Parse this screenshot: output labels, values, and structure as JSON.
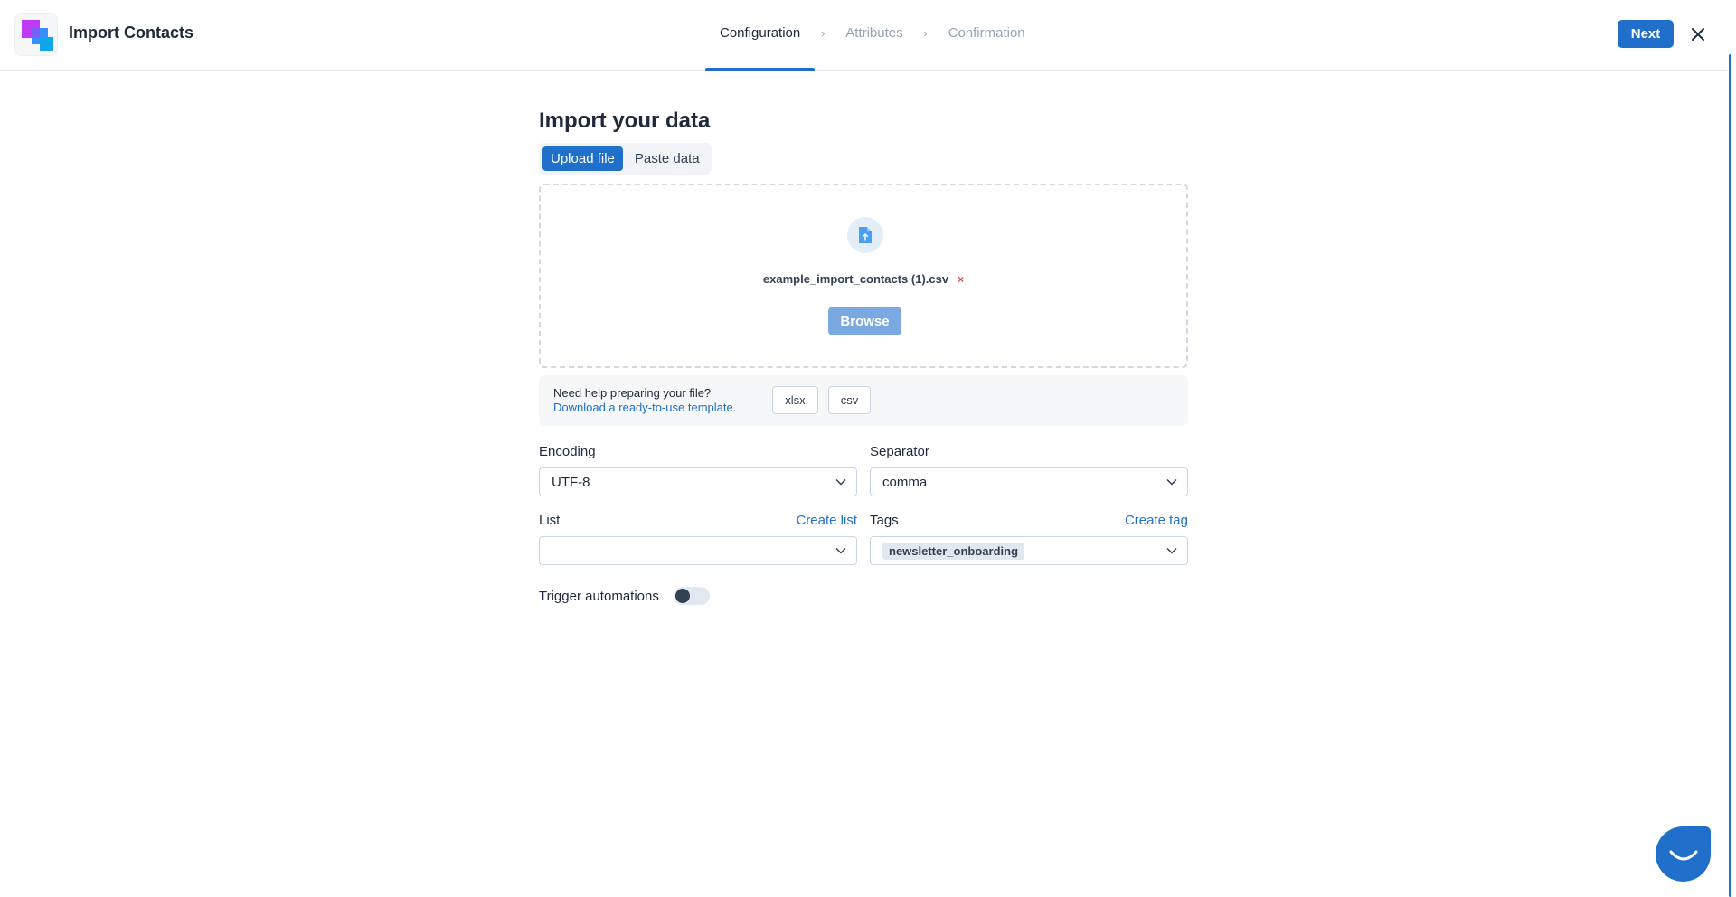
{
  "header": {
    "title": "Import Contacts",
    "steps": [
      {
        "label": "Configuration"
      },
      {
        "label": "Attributes"
      },
      {
        "label": "Confirmation"
      }
    ],
    "step_separator": "›",
    "next_label": "Next",
    "active_step": "Configuration"
  },
  "main": {
    "title": "Import your data",
    "tabs": [
      {
        "label": "Upload file"
      },
      {
        "label": "Paste data"
      }
    ],
    "active_tab": "Upload file",
    "upload": {
      "file_name": "example_import_contacts (1).csv",
      "remove_symbol": "×",
      "browse_label": "Browse",
      "icon": "file-upload-icon"
    },
    "help": {
      "title": "Need help preparing your file?",
      "subtitle": "Download a ready-to-use template.",
      "formats": [
        "xlsx",
        "csv"
      ]
    },
    "fields": {
      "encoding": {
        "label": "Encoding",
        "value": "UTF-8"
      },
      "separator": {
        "label": "Separator",
        "value": "comma"
      },
      "list": {
        "label": "List",
        "link": "Create list",
        "value": ""
      },
      "tags": {
        "label": "Tags",
        "link": "Create tag",
        "selected": [
          "newsletter_onboarding"
        ]
      }
    },
    "trigger": {
      "label": "Trigger automations",
      "enabled": false
    }
  },
  "colors": {
    "accent": "#1f6fcb",
    "accent_light": "#7aa9e1",
    "text": "#1e293b",
    "muted": "#94a3b8",
    "remove": "#e04646"
  },
  "icons": {
    "close": "close-icon",
    "chevron": "chevron-down-icon",
    "chat": "chat-icon"
  }
}
